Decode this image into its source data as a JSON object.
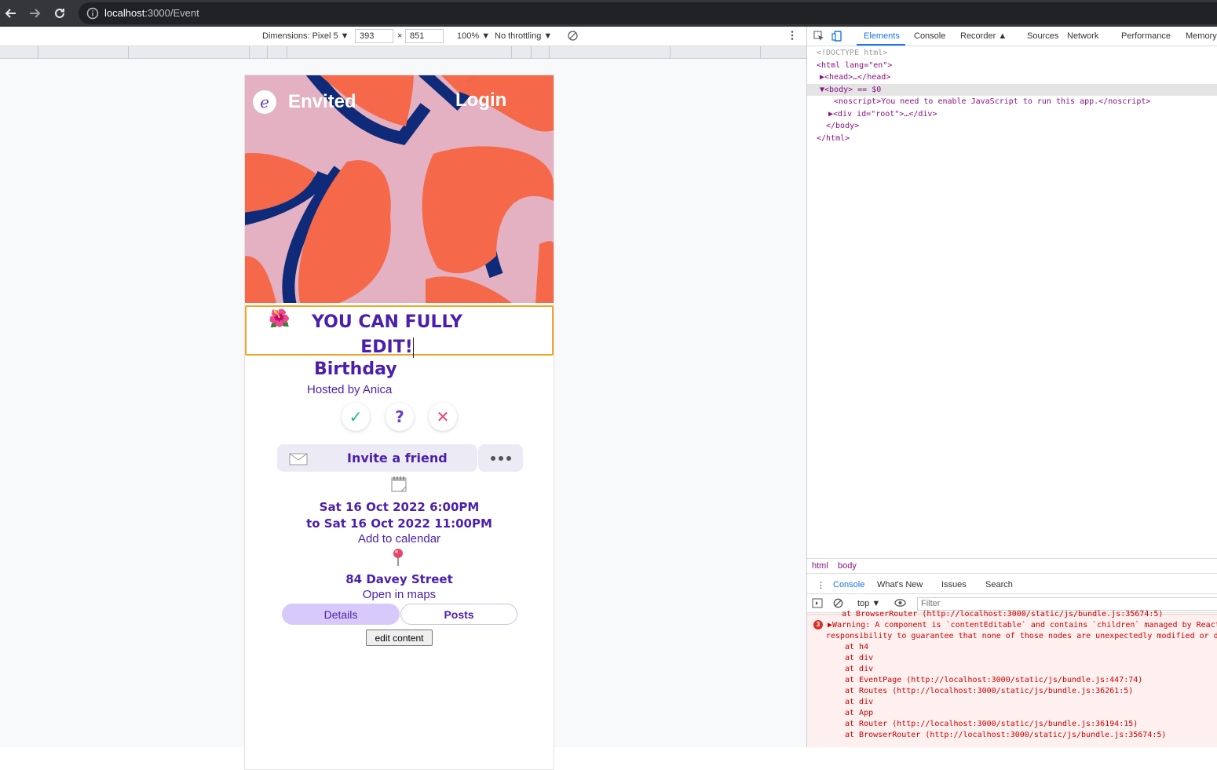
{
  "browser": {
    "url_host": "localhost",
    "url_rest": ":3000/Event"
  },
  "device_toolbar": {
    "dimensions_label": "Dimensions: Pixel 5 ▼",
    "width": "393",
    "times": "×",
    "height": "851",
    "zoom": "100% ▼",
    "throttling": "No throttling ▼"
  },
  "app": {
    "brand": "Envited",
    "logo_letter": "e",
    "login": "Login",
    "title_line1": "YOU CAN FULLY",
    "title_line2": "EDIT!",
    "title_emoji": "🌺",
    "subtitle": "Birthday",
    "host": "Hosted by Anica",
    "rsvp": {
      "yes": "✓",
      "maybe": "?",
      "no": "✕"
    },
    "invite_label": "Invite a friend",
    "invite_emoji": "✉️",
    "calendar_emoji": "🗓️",
    "date_start": "Sat 16 Oct 2022 6:00PM",
    "date_end": "to Sat 16 Oct 2022 11:00PM",
    "add_calendar": "Add to calendar",
    "pin_emoji": "📍",
    "address": "84 Davey Street",
    "open_maps": "Open in maps",
    "tabs": {
      "details": "Details",
      "posts": "Posts"
    },
    "edit_button": "edit content"
  },
  "devtools": {
    "tabs": [
      "Elements",
      "Console",
      "Recorder",
      "Sources",
      "Network",
      "Performance",
      "Memory"
    ],
    "dom_lines": {
      "doctype": "<!DOCTYPE html>",
      "html_open": "<html lang=\"en\">",
      "head": "▶<head>…</head>",
      "body": "▼<body> == $0",
      "noscript": "<noscript>You need to enable JavaScript to run this app.</noscript>",
      "root_div": "▶<div id=\"root\">…</div>",
      "body_close": "</body>",
      "html_close": "</html>"
    },
    "breadcrumbs": [
      "html",
      "body"
    ],
    "drawer_tabs": [
      "Console",
      "What's New",
      "Issues",
      "Search"
    ],
    "console_context": "top ▼",
    "filter_placeholder": "Filter",
    "log": {
      "first": "at BrowserRouter (http://localhost:3000/static/js/bundle.js:35674:5)",
      "badge": "3",
      "warning1": "▶Warning: A component is `contentEditable` and contains `children` managed by React",
      "warning2": "responsibility to guarantee that none of those nodes are unexpectedly modified or du",
      "stack": [
        "at h4",
        "at div",
        "at div",
        "at EventPage (http://localhost:3000/static/js/bundle.js:447:74)",
        "at Routes (http://localhost:3000/static/js/bundle.js:36261:5)",
        "at div",
        "at App",
        "at Router (http://localhost:3000/static/js/bundle.js:36194:15)",
        "at BrowserRouter (http://localhost:3000/static/js/bundle.js:35674:5)"
      ]
    }
  },
  "colors": {
    "brand_purple": "#4b1fad",
    "hero_pink": "#e3b1c1",
    "hero_orange": "#f5694a",
    "hero_navy": "#0f2a78",
    "rsvp_yes": "#1bb68c",
    "rsvp_no": "#e8456b"
  }
}
